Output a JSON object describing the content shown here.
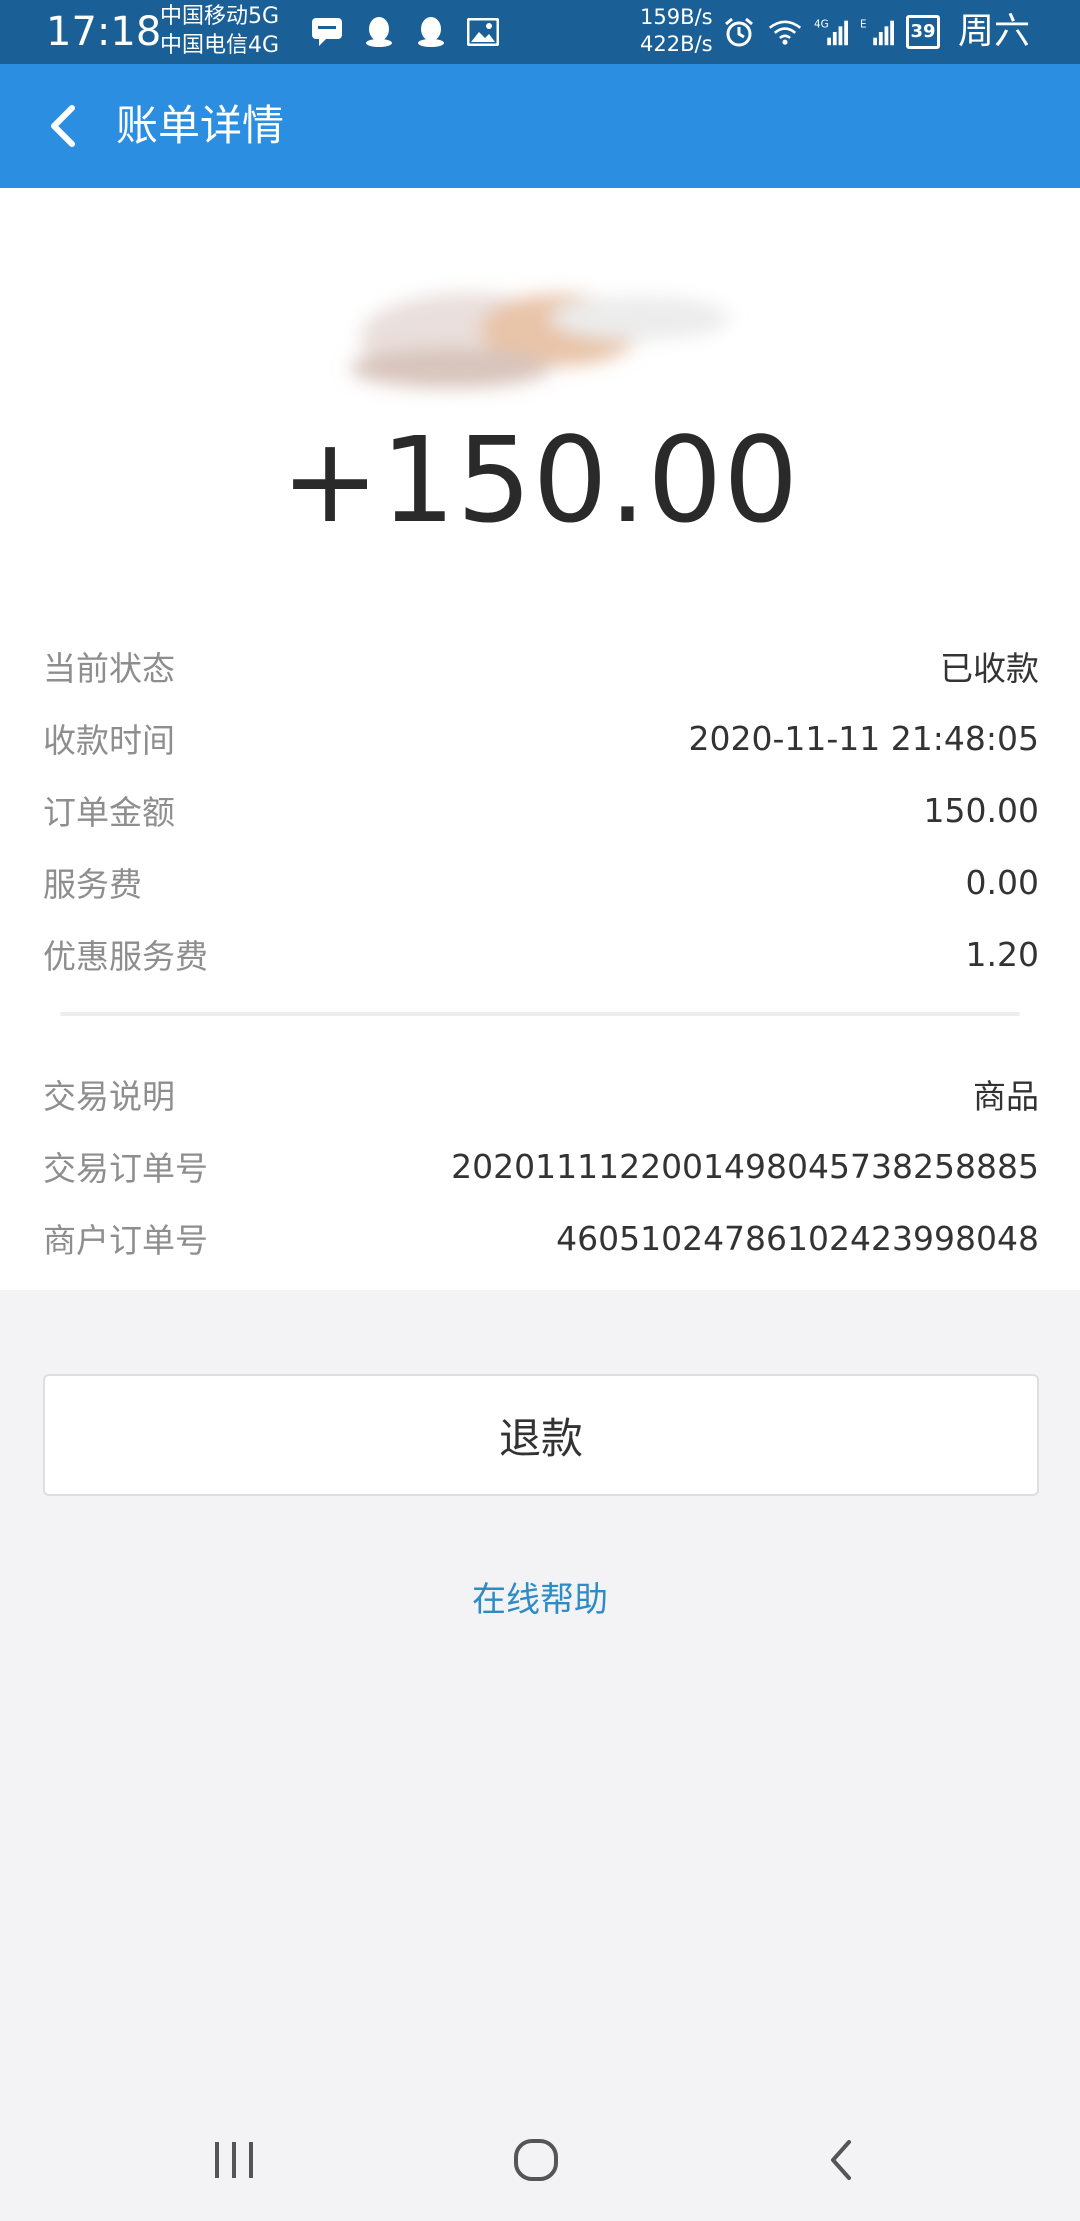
{
  "status_bar": {
    "time": "17:18",
    "carrier_1": "中国移动5G",
    "carrier_2": "中国电信4G",
    "speed_down": "159B/s",
    "speed_up": "422B/s",
    "battery": "39",
    "day": "周六",
    "icons": [
      "message-icon",
      "qq-icon",
      "qq-icon",
      "image-icon",
      "alarm-icon",
      "wifi-icon",
      "signal-4g-icon",
      "signal-e-icon"
    ]
  },
  "app_bar": {
    "title": "账单详情",
    "back_icon": "chevron-left-icon"
  },
  "summary": {
    "amount": "+150.00"
  },
  "details_group_1": [
    {
      "label": "当前状态",
      "value": "已收款"
    },
    {
      "label": "收款时间",
      "value": "2020-11-11 21:48:05"
    },
    {
      "label": "订单金额",
      "value": "150.00"
    },
    {
      "label": "服务费",
      "value": "0.00"
    },
    {
      "label": "优惠服务费",
      "value": "1.20"
    }
  ],
  "details_group_2": [
    {
      "label": "交易说明",
      "value": "商品"
    },
    {
      "label": "交易订单号",
      "value": "2020111122001498045738258885"
    },
    {
      "label": "商户订单号",
      "value": "46051024786102423998048"
    }
  ],
  "actions": {
    "refund_label": "退款",
    "help_label": "在线帮助"
  },
  "colors": {
    "status_bar": "#1a5f96",
    "app_bar": "#2c8ee0",
    "link": "#2f8bc6"
  },
  "nav_bar": {
    "icons": [
      "recent-apps-icon",
      "home-icon",
      "back-icon"
    ]
  }
}
